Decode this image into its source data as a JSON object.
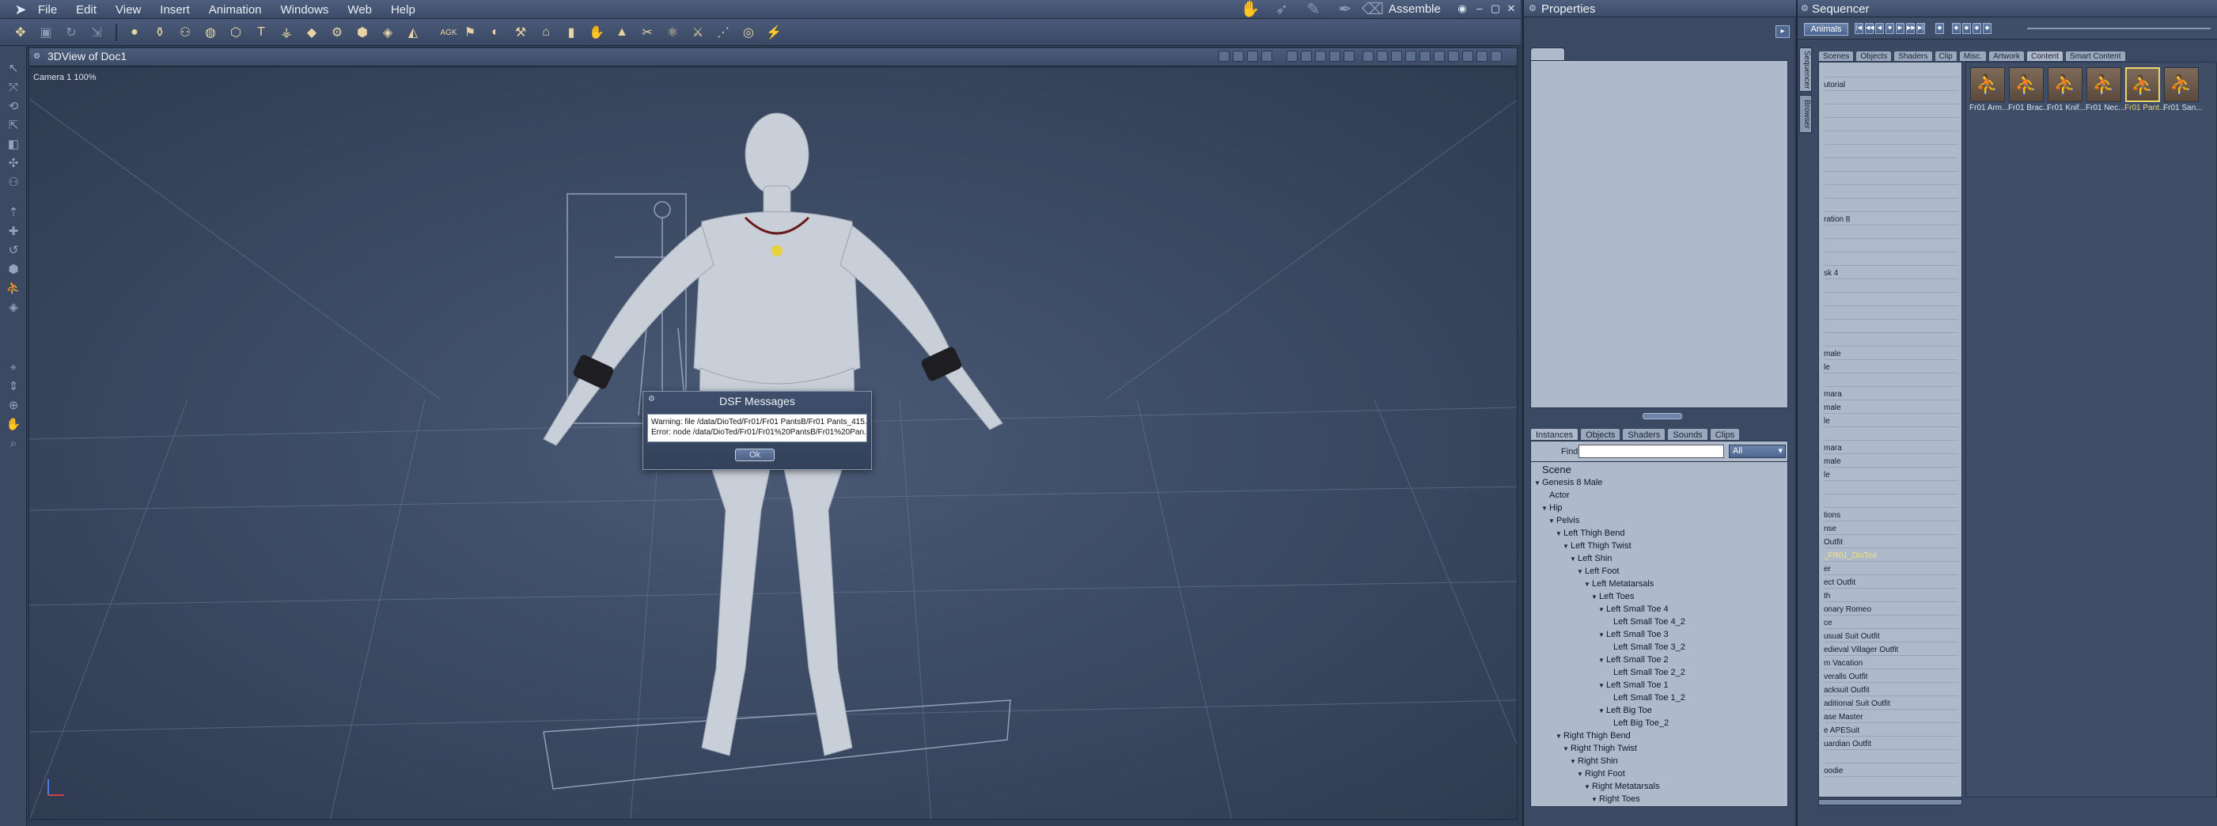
{
  "menubar": {
    "items": [
      "File",
      "Edit",
      "View",
      "Insert",
      "Animation",
      "Windows",
      "Web",
      "Help"
    ],
    "assemble": "Assemble"
  },
  "toolbar": {
    "tools": [
      "sphere",
      "table",
      "pose",
      "head",
      "joint",
      "text",
      "cloth",
      "floor",
      "gear",
      "geometry",
      "drape",
      "figure",
      "tool-a",
      "tool-b",
      "ik",
      "house",
      "cylinder",
      "hand",
      "cone",
      "scissors",
      "dna",
      "knife",
      "nodes",
      "target",
      "brush"
    ],
    "agk_label": "AGK"
  },
  "viewport": {
    "title": "3DView of Doc1",
    "camera": "Camera 1 100%"
  },
  "dialog": {
    "title": "DSF Messages",
    "line1": "Warning: file /data/DioTed/Fr01/Fr01 PantsB/Fr01 Pants_415...",
    "line2": "Error: node /data/DioTed/Fr01/Fr01%20PantsB/Fr01%20Pan...",
    "ok": "Ok"
  },
  "properties": {
    "title": "Properties",
    "tabs": [
      "Instances",
      "Objects",
      "Shaders",
      "Sounds",
      "Clips"
    ],
    "find_label": "Find:",
    "find_value": "",
    "filter": "All",
    "tree": [
      {
        "label": "Scene",
        "level": 0,
        "arrow": false,
        "scene": true
      },
      {
        "label": "Genesis 8 Male",
        "level": 0,
        "arrow": true
      },
      {
        "label": "Actor",
        "level": 1,
        "arrow": false
      },
      {
        "label": "Hip",
        "level": 1,
        "arrow": true
      },
      {
        "label": "Pelvis",
        "level": 2,
        "arrow": true
      },
      {
        "label": "Left Thigh Bend",
        "level": 3,
        "arrow": true
      },
      {
        "label": "Left Thigh Twist",
        "level": 4,
        "arrow": true
      },
      {
        "label": "Left Shin",
        "level": 5,
        "arrow": true
      },
      {
        "label": "Left Foot",
        "level": 6,
        "arrow": true
      },
      {
        "label": "Left Metatarsals",
        "level": 7,
        "arrow": true
      },
      {
        "label": "Left Toes",
        "level": 8,
        "arrow": true
      },
      {
        "label": "Left Small Toe 4",
        "level": 9,
        "arrow": true
      },
      {
        "label": "Left Small Toe 4_2",
        "level": 10,
        "arrow": false
      },
      {
        "label": "Left Small Toe 3",
        "level": 9,
        "arrow": true
      },
      {
        "label": "Left Small Toe 3_2",
        "level": 10,
        "arrow": false
      },
      {
        "label": "Left Small Toe 2",
        "level": 9,
        "arrow": true
      },
      {
        "label": "Left Small Toe 2_2",
        "level": 10,
        "arrow": false
      },
      {
        "label": "Left Small Toe 1",
        "level": 9,
        "arrow": true
      },
      {
        "label": "Left Small Toe 1_2",
        "level": 10,
        "arrow": false
      },
      {
        "label": "Left Big Toe",
        "level": 9,
        "arrow": true
      },
      {
        "label": "Left Big Toe_2",
        "level": 10,
        "arrow": false
      },
      {
        "label": "Right Thigh Bend",
        "level": 3,
        "arrow": true
      },
      {
        "label": "Right Thigh Twist",
        "level": 4,
        "arrow": true
      },
      {
        "label": "Right Shin",
        "level": 5,
        "arrow": true
      },
      {
        "label": "Right Foot",
        "level": 6,
        "arrow": true
      },
      {
        "label": "Right Metatarsals",
        "level": 7,
        "arrow": true
      },
      {
        "label": "Right Toes",
        "level": 8,
        "arrow": true
      }
    ]
  },
  "sequencer": {
    "title": "Sequencer",
    "animals_btn": "Animals",
    "vtab1": "Sequencer",
    "vtab2": "Browser",
    "tabs": [
      "Scenes",
      "Objects",
      "Shaders",
      "Clip",
      "Misc.",
      "Artwork",
      "Content",
      "Smart Content"
    ],
    "list": [
      "",
      "utorial",
      "",
      "",
      "",
      "",
      "",
      "",
      "",
      "",
      "",
      "ration 8",
      "",
      "",
      "",
      "sk 4",
      "",
      "",
      "",
      "",
      "",
      "male",
      "le",
      "",
      "mara",
      "male",
      "le",
      "",
      "mara",
      "male",
      "le",
      "",
      "",
      "tions",
      "nse",
      "Outfit",
      "_FR01_DioTed",
      "er",
      "ect Outfit",
      "th",
      "onary Romeo",
      "ce",
      "usual Suit Outfit",
      "edieval Villager Outfit",
      "m Vacation",
      "veralls Outfit",
      "acksuit Outfit",
      "aditional Suit Outfit",
      "ase Master",
      "e APESuit",
      "uardian Outfit",
      "",
      "oodie"
    ],
    "selected_index": 36,
    "thumbs": [
      {
        "label": "Fr01 Arm..."
      },
      {
        "label": "Fr01 Brac..."
      },
      {
        "label": "Fr01 Knif..."
      },
      {
        "label": "Fr01 Nec..."
      },
      {
        "label": "Fr01 Pant..."
      },
      {
        "label": "Fr01 San..."
      }
    ],
    "selected_thumb": 4
  },
  "colors": {
    "accent": "#e8d56b",
    "panel": "#aeb9ca",
    "viewport_bg": "#3a4861"
  }
}
